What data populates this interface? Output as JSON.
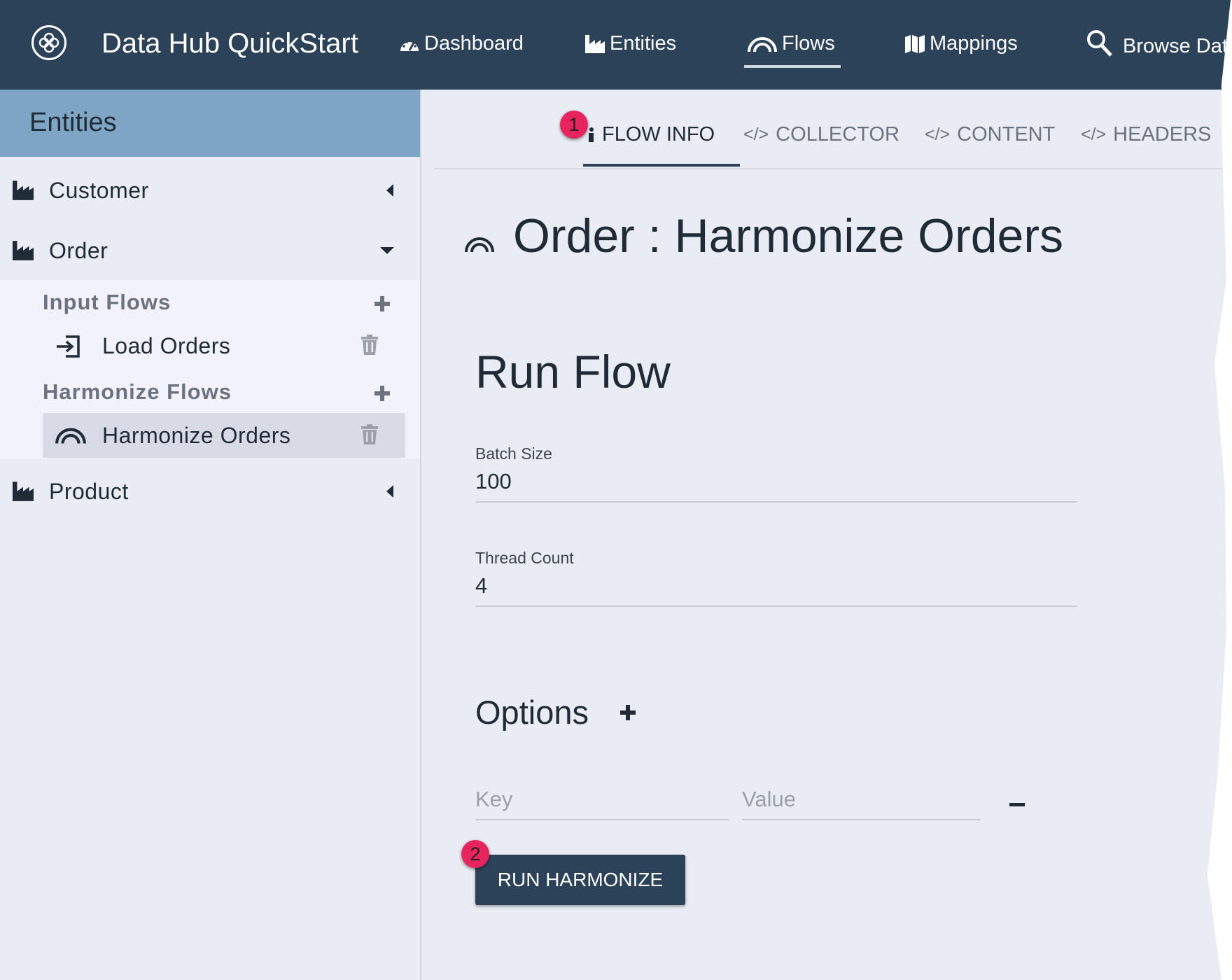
{
  "app": {
    "title": "Data Hub QuickStart",
    "logo_icon": "flower-logo-icon"
  },
  "nav": {
    "items": [
      {
        "label": "Dashboard",
        "icon": "tachometer-icon"
      },
      {
        "label": "Entities",
        "icon": "industry-icon"
      },
      {
        "label": "Flows",
        "icon": "rainbow-icon",
        "active": true
      },
      {
        "label": "Mappings",
        "icon": "map-icon"
      },
      {
        "label": "Browse Data",
        "icon": "search-icon"
      }
    ]
  },
  "sidebar": {
    "header": "Entities",
    "entities": [
      {
        "label": "Customer",
        "expanded": false
      },
      {
        "label": "Order",
        "expanded": true
      },
      {
        "label": "Product",
        "expanded": false
      }
    ],
    "input_flows_label": "Input Flows",
    "harmonize_flows_label": "Harmonize Flows",
    "input_flows": [
      {
        "label": "Load Orders"
      }
    ],
    "harmonize_flows": [
      {
        "label": "Harmonize Orders",
        "selected": true
      }
    ]
  },
  "tabs": [
    {
      "label": "FLOW INFO",
      "icon": "info-icon",
      "active": true
    },
    {
      "label": "COLLECTOR",
      "icon": "code-icon"
    },
    {
      "label": "CONTENT",
      "icon": "code-icon"
    },
    {
      "label": "HEADERS",
      "icon": "code-icon"
    }
  ],
  "main": {
    "page_title": "Order : Harmonize Orders",
    "section_title": "Run Flow",
    "batch_size": {
      "label": "Batch Size",
      "value": "100"
    },
    "thread_count": {
      "label": "Thread Count",
      "value": "4"
    },
    "options_title": "Options",
    "key_placeholder": "Key",
    "value_placeholder": "Value",
    "run_button": "RUN HARMONIZE"
  },
  "callouts": {
    "first": "1",
    "second": "2"
  },
  "colors": {
    "navbar": "#2c4258",
    "sidebar_header": "#7fa5c4",
    "callout": "#e8245f",
    "button": "#2c4258"
  }
}
